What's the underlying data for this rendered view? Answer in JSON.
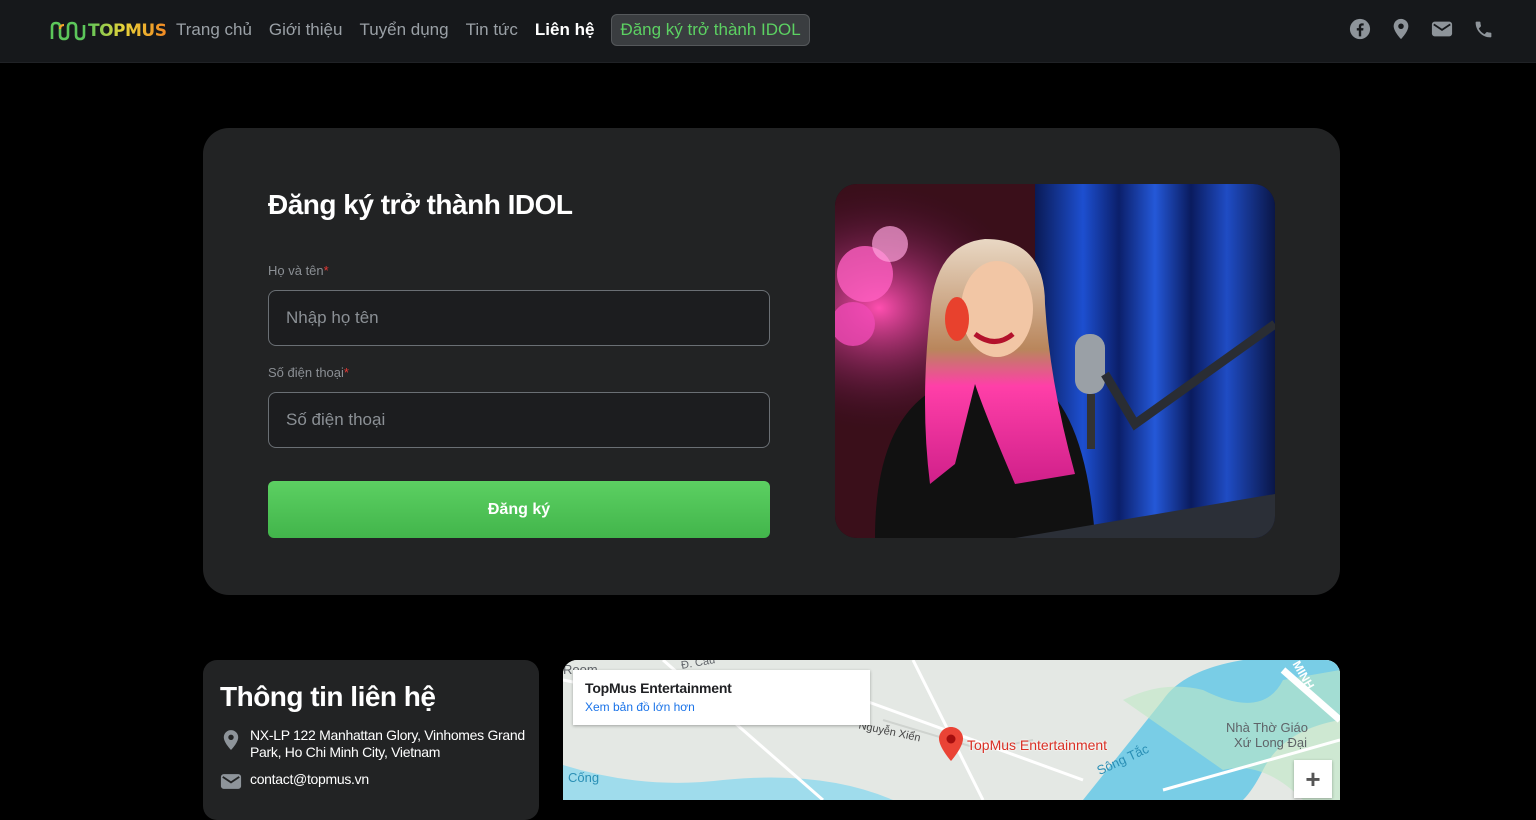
{
  "header": {
    "logo_text": "TOPMUS",
    "nav": [
      {
        "label": "Trang chủ"
      },
      {
        "label": "Giới thiệu"
      },
      {
        "label": "Tuyển dụng"
      },
      {
        "label": "Tin tức"
      },
      {
        "label": "Liên hệ"
      }
    ],
    "cta_label": "Đăng ký trở thành IDOL",
    "social_icons": [
      "facebook-icon",
      "location-pin-icon",
      "mail-icon",
      "phone-icon"
    ]
  },
  "form": {
    "title": "Đăng ký trở thành IDOL",
    "name_label": "Họ và tên",
    "name_placeholder": "Nhập họ tên",
    "phone_label": "Số điện thoại",
    "phone_placeholder": "Số điện thoại",
    "required_mark": "*",
    "submit_label": "Đăng ký"
  },
  "contact": {
    "title": "Thông tin liên hệ",
    "address": "NX-LP 122 Manhattan Glory, Vinhomes Grand Park, Ho Chi Minh City, Vietnam",
    "email": "contact@topmus.vn"
  },
  "map": {
    "place_name": "TopMus Entertainment",
    "view_larger": "Xem bản đồ lớn hơn",
    "marker_label": "TopMus Entertainment",
    "labels": {
      "church": "Nhà Thờ Giáo",
      "church2": "Xứ Long Đại",
      "river": "Sông Tắc",
      "road": "Nguyễn Xiển",
      "cong": "Cống",
      "minh": "MINH",
      "room": "Room",
      "cau": "Đ. Cầu"
    },
    "zoom_in": "+"
  },
  "colors": {
    "accent_green": "#5cd062",
    "card_bg": "#222324",
    "topbar_bg": "#16181b"
  }
}
